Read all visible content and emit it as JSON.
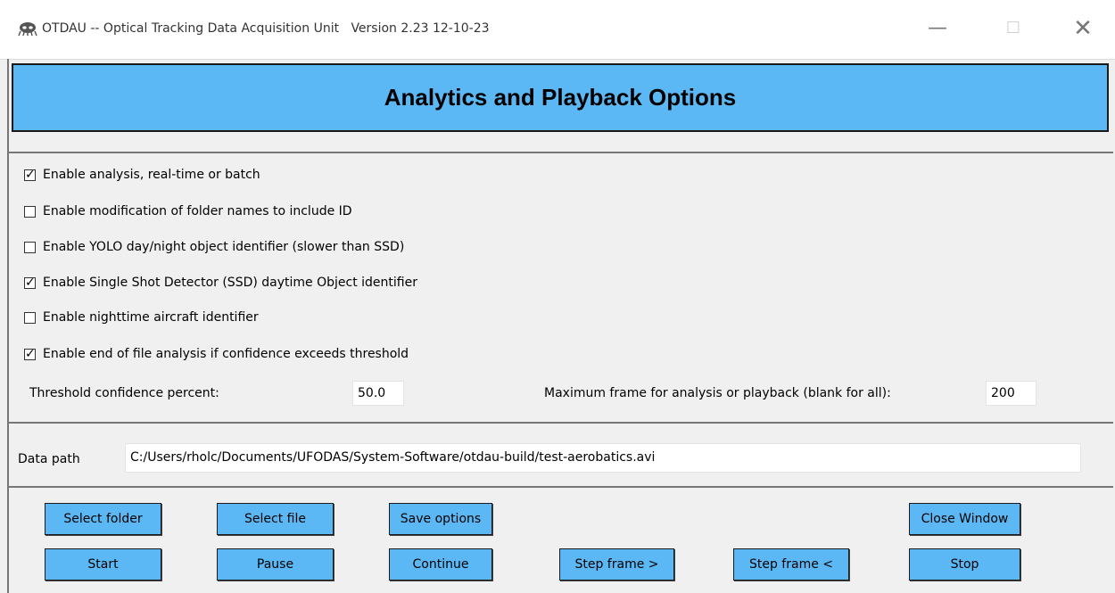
{
  "window": {
    "title": "OTDAU -- Optical Tracking Data Acquisition Unit",
    "version": "Version 2.23 12-10-23",
    "icon": "alien-icon",
    "min_label": "—",
    "max_label": "☐",
    "close_label": "✕"
  },
  "header": {
    "title": "Analytics and Playback Options",
    "bg_color": "#5bb8f5"
  },
  "options": [
    {
      "label": "Enable analysis, real-time or batch",
      "checked": true
    },
    {
      "label": "Enable modification of folder names to include ID",
      "checked": false
    },
    {
      "label": "Enable YOLO day/night object identifier (slower than SSD)",
      "checked": false
    },
    {
      "label": "Enable Single Shot Detector (SSD) daytime Object identifier",
      "checked": true
    },
    {
      "label": "Enable nighttime aircraft identifier",
      "checked": false
    },
    {
      "label": "Enable end of file analysis if confidence exceeds threshold",
      "checked": true
    }
  ],
  "threshold": {
    "label": "Threshold confidence percent:",
    "value": "50.0"
  },
  "max_frame": {
    "label": "Maximum frame for analysis or playback (blank for all):",
    "value": "200"
  },
  "data_path": {
    "label": "Data path",
    "value": "C:/Users/rholc/Documents/UFODAS/System-Software/otdau-build/test-aerobatics.avi"
  },
  "buttons": {
    "select_folder": "Select folder",
    "select_file": "Select file",
    "save_options": "Save options",
    "close_window": "Close Window",
    "start": "Start",
    "pause": "Pause",
    "continue": "Continue",
    "step_forward": "Step frame >",
    "step_back": "Step frame <",
    "stop": "Stop"
  }
}
